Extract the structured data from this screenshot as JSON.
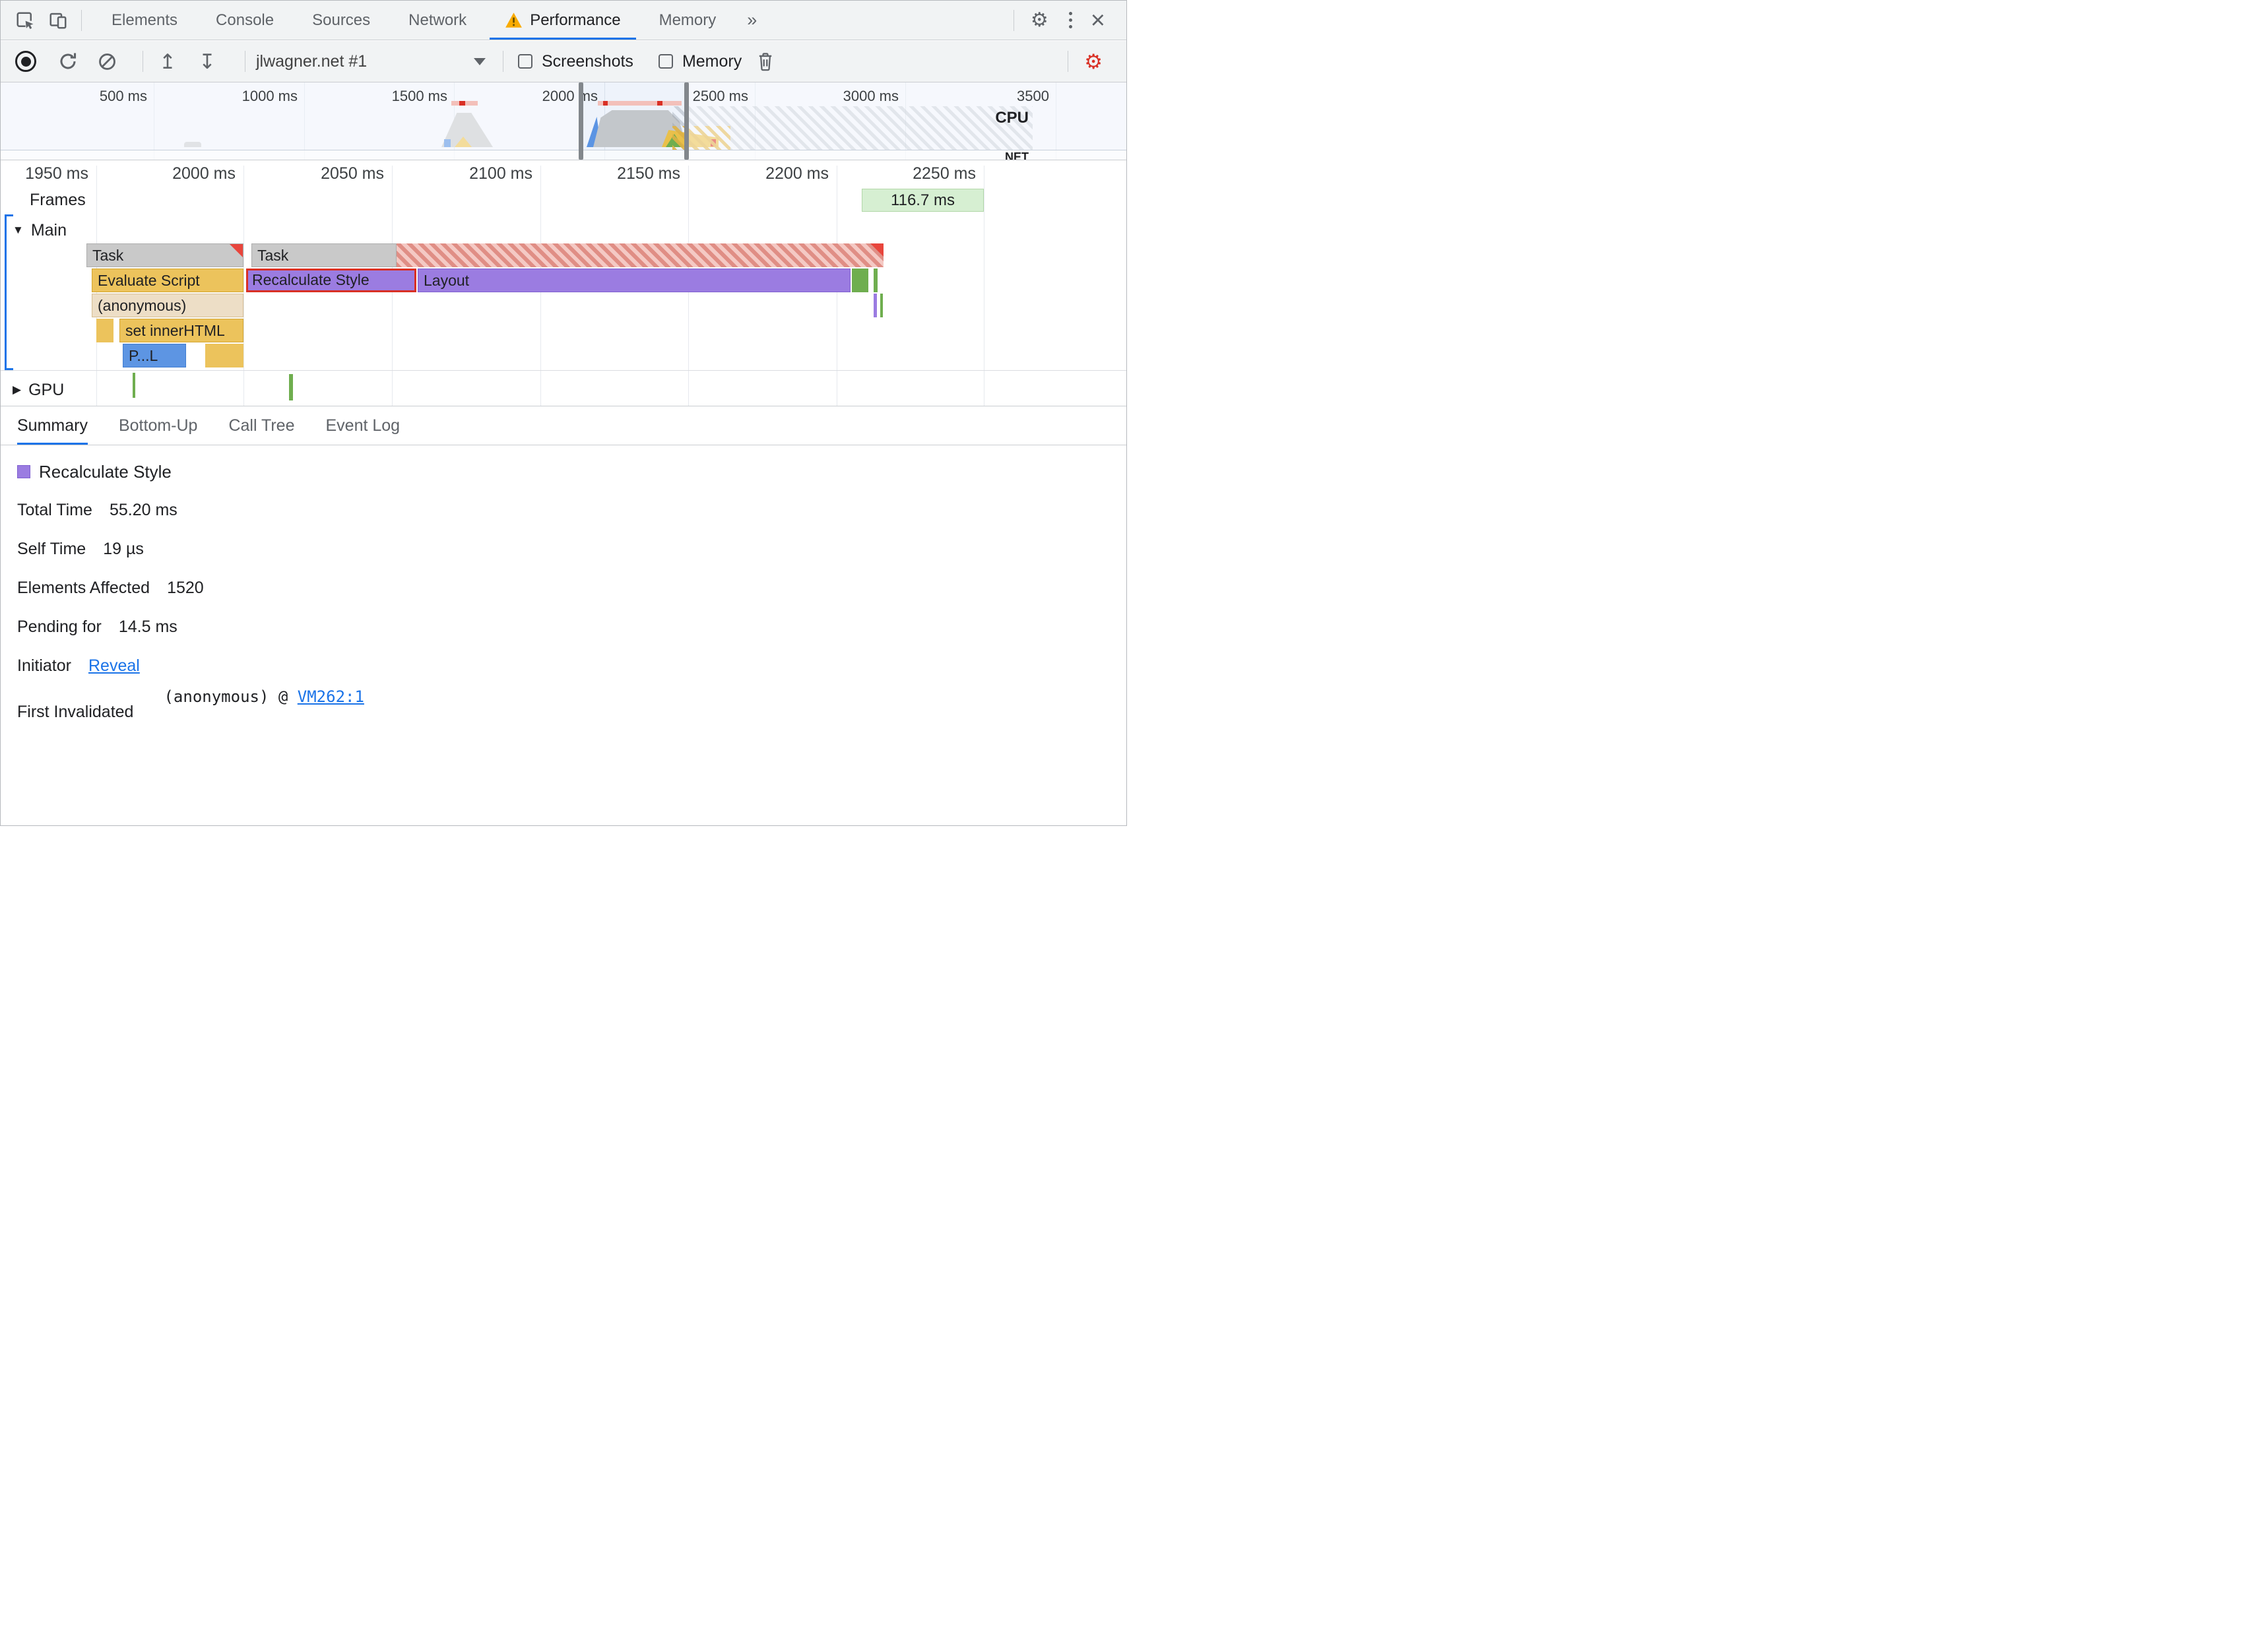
{
  "tabbar": {
    "tabs": [
      {
        "label": "Elements"
      },
      {
        "label": "Console"
      },
      {
        "label": "Sources"
      },
      {
        "label": "Network"
      },
      {
        "label": "Performance"
      },
      {
        "label": "Memory"
      }
    ],
    "more_tabs_glyph": "»",
    "settings_glyph": "⚙",
    "close_glyph": "×"
  },
  "toolbar": {
    "profile_select": "jlwagner.net #1",
    "screenshots_label": "Screenshots",
    "memory_label": "Memory",
    "load_glyph": "↥",
    "save_glyph": "↧",
    "capture_settings_glyph": "⚙"
  },
  "overview": {
    "ticks": [
      "500 ms",
      "1000 ms",
      "1500 ms",
      "2000 ms",
      "2500 ms",
      "3000 ms",
      "3500"
    ],
    "cpu_label": "CPU",
    "net_label": "NET"
  },
  "timeline": {
    "ticks": [
      "1950 ms",
      "2000 ms",
      "2050 ms",
      "2100 ms",
      "2150 ms",
      "2200 ms",
      "2250 ms"
    ],
    "frames_label": "Frames",
    "frame_duration": "116.7 ms"
  },
  "tracks": {
    "main": {
      "disclosure": "▼",
      "label": "Main"
    },
    "gpu": {
      "disclosure": "▶",
      "label": "GPU"
    },
    "bars": {
      "task1": "Task",
      "task2": "Task",
      "evaluate_script": "Evaluate Script",
      "recalculate_style": "Recalculate Style",
      "layout": "Layout",
      "anonymous": "(anonymous)",
      "set_inner_html": "set innerHTML",
      "parse_html": "P...L"
    }
  },
  "detail_tabs": [
    {
      "label": "Summary"
    },
    {
      "label": "Bottom-Up"
    },
    {
      "label": "Call Tree"
    },
    {
      "label": "Event Log"
    }
  ],
  "summary": {
    "title": "Recalculate Style",
    "rows": [
      {
        "label": "Total Time",
        "value": "55.20 ms"
      },
      {
        "label": "Self Time",
        "value": "19 µs"
      },
      {
        "label": "Elements Affected",
        "value": "1520"
      },
      {
        "label": "Pending for",
        "value": "14.5 ms"
      }
    ],
    "initiator": {
      "label": "Initiator",
      "link": "Reveal"
    },
    "first_invalidated": {
      "label": "First Invalidated",
      "code": "(anonymous) @",
      "link": "VM262:1"
    }
  },
  "colors": {
    "accent_blue": "#1a73e8",
    "scripting_yellow": "#ecc35c",
    "rendering_purple": "#9b7ce1",
    "task_gray": "#c9c9c9",
    "long_task_red": "#e8453c",
    "highlight_red": "#d93025",
    "frame_green": "#d6efd2",
    "gpu_green": "#6fae4f",
    "warning_amber": "#f9ab00"
  }
}
